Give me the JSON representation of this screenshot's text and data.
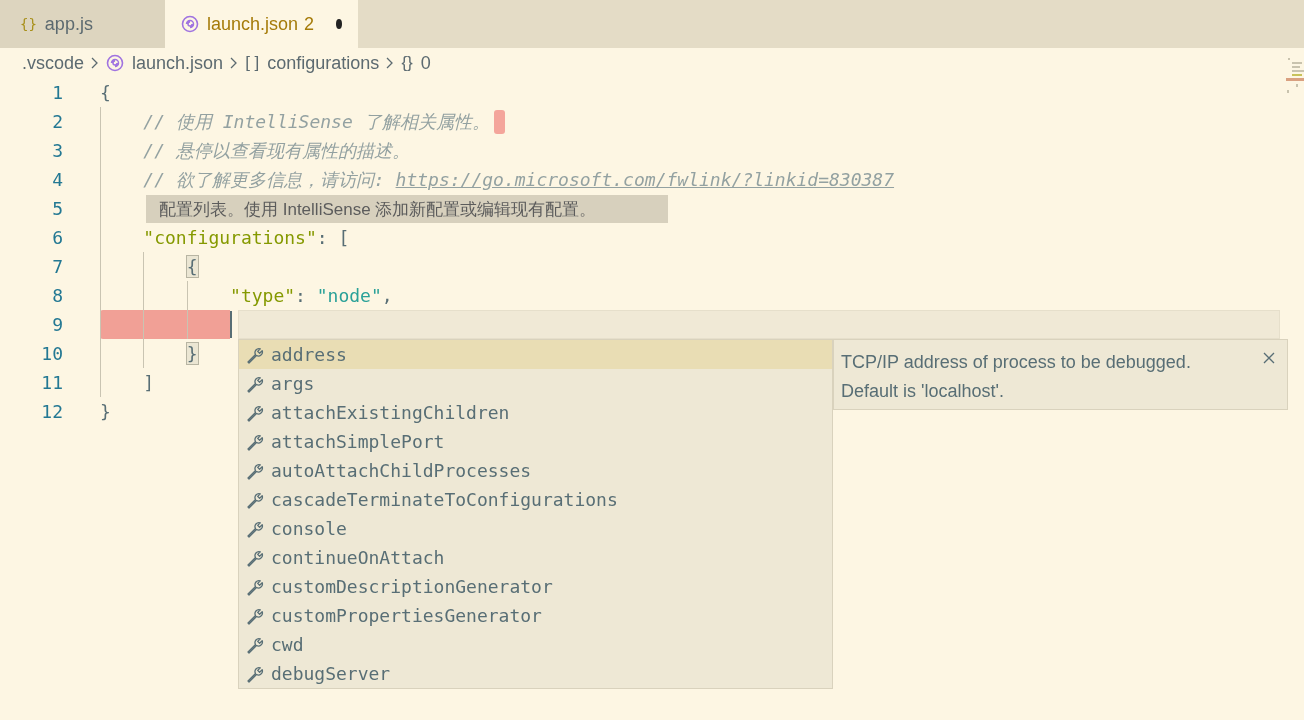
{
  "tabs": [
    {
      "label": "app.js",
      "icon": "{}",
      "selected": false
    },
    {
      "label": "launch.json",
      "problems": "2",
      "dirty": true,
      "selected": true
    }
  ],
  "breadcrumb": [
    {
      "text": ".vscode",
      "kind": "folder"
    },
    {
      "text": "launch.json",
      "kind": "file"
    },
    {
      "symbol": "[ ]",
      "text": "configurations",
      "kind": "array"
    },
    {
      "symbol": "{}",
      "text": "0",
      "kind": "object"
    }
  ],
  "lines": [
    {
      "number": "1",
      "tokens": [
        {
          "kind": "punct",
          "text": "{"
        }
      ]
    },
    {
      "number": "2",
      "error_marker": true,
      "tokens": [
        {
          "kind": "comment",
          "text": "    // 使用 IntelliSense 了解相关属性。"
        }
      ]
    },
    {
      "number": "3",
      "tokens": [
        {
          "kind": "comment",
          "text": "    // 悬停以查看现有属性的描述。"
        }
      ]
    },
    {
      "number": "4",
      "tokens": [
        {
          "kind": "comment",
          "text": "    // 欲了解更多信息，请访问: "
        },
        {
          "kind": "link",
          "text": "https://go.microsoft.com/fwlink/?linkid=830387"
        }
      ]
    },
    {
      "number": "5"
    },
    {
      "number": "6",
      "tokens": [
        {
          "kind": "key",
          "text": "    \"configurations\""
        },
        {
          "kind": "punct",
          "text": ": ["
        }
      ]
    },
    {
      "number": "7",
      "tokens": [
        {
          "kind": "punct",
          "text": "        {",
          "matched": true
        }
      ]
    },
    {
      "number": "8",
      "tokens": [
        {
          "kind": "key",
          "text": "            \"type\""
        },
        {
          "kind": "punct",
          "text": ": "
        },
        {
          "kind": "string",
          "text": "\"node\""
        },
        {
          "kind": "punct",
          "text": ","
        }
      ]
    },
    {
      "number": "9",
      "current": true,
      "indent_error": true
    },
    {
      "number": "10",
      "tokens": [
        {
          "kind": "punct",
          "text": "        }",
          "matched": true
        }
      ]
    },
    {
      "number": "11",
      "tokens": [
        {
          "kind": "punct",
          "text": "    ]"
        }
      ]
    },
    {
      "number": "12",
      "tokens": [
        {
          "kind": "punct",
          "text": "}"
        }
      ]
    }
  ],
  "hover": {
    "text": "配置列表。使用 IntelliSense 添加新配置或编辑现有配置。"
  },
  "suggestions": [
    {
      "label": "address",
      "selected": true
    },
    {
      "label": "args",
      "selected": false
    },
    {
      "label": "attachExistingChildren",
      "selected": false
    },
    {
      "label": "attachSimplePort",
      "selected": false
    },
    {
      "label": "autoAttachChildProcesses",
      "selected": false
    },
    {
      "label": "cascadeTerminateToConfigurations",
      "selected": false
    },
    {
      "label": "console",
      "selected": false
    },
    {
      "label": "continueOnAttach",
      "selected": false
    },
    {
      "label": "customDescriptionGenerator",
      "selected": false
    },
    {
      "label": "customPropertiesGenerator",
      "selected": false
    },
    {
      "label": "cwd",
      "selected": false
    },
    {
      "label": "debugServer",
      "selected": false
    }
  ],
  "details": {
    "text": "TCP/IP address of process to be debugged. Default is 'localhost'."
  }
}
